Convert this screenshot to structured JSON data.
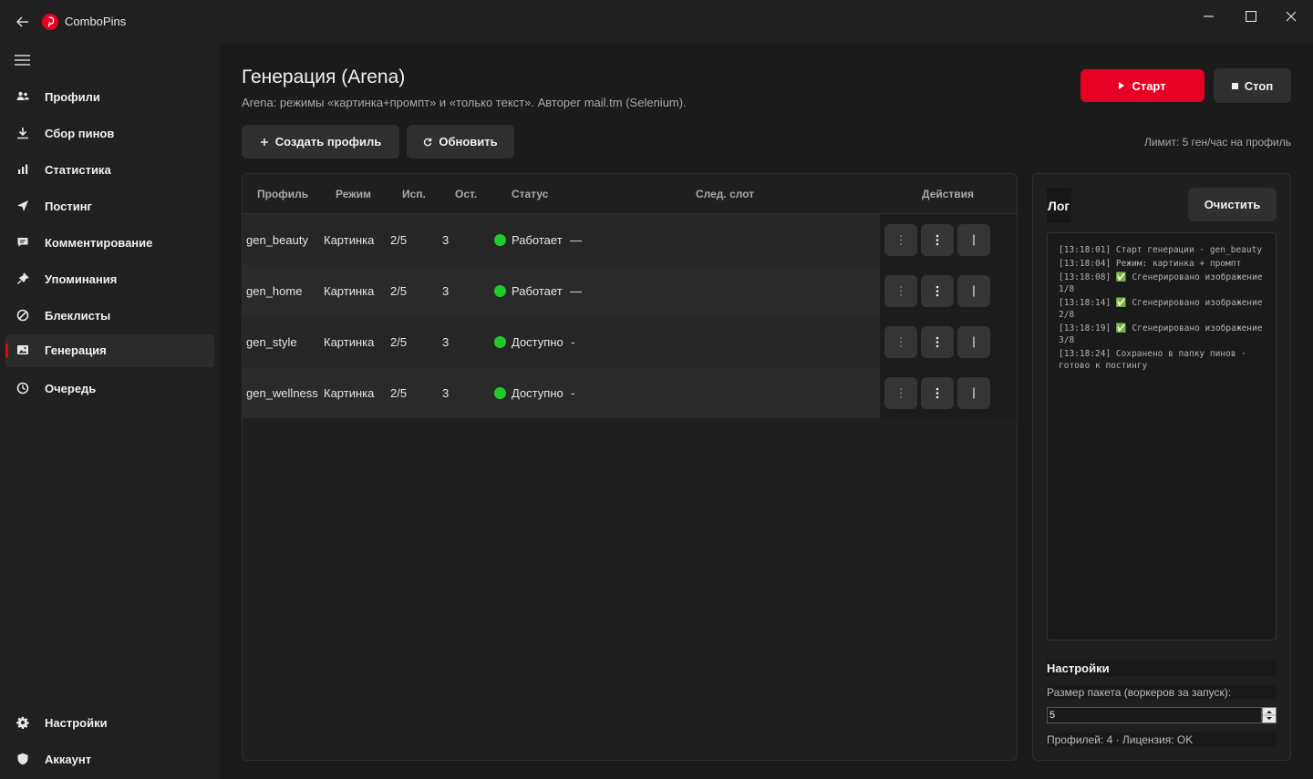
{
  "app": {
    "title": "ComboPins",
    "icons": {
      "logo": "pinterest-logo-icon",
      "back": "arrow-left-icon"
    }
  },
  "window_controls": {
    "icons": [
      "minimize-icon",
      "maximize-icon",
      "close-icon"
    ]
  },
  "sidebar": {
    "items": [
      {
        "label": "Профили",
        "icon": "users-icon"
      },
      {
        "label": "Сбор пинов",
        "icon": "download-icon"
      },
      {
        "label": "Статистика",
        "icon": "bar-chart-icon"
      },
      {
        "label": "Постинг",
        "icon": "send-icon"
      },
      {
        "label": "Комментирование",
        "icon": "comment-icon"
      },
      {
        "label": "Упоминания",
        "icon": "pin-icon"
      },
      {
        "label": "Блеклисты",
        "icon": "block-icon"
      },
      {
        "label": "Генерация",
        "icon": "image-icon",
        "active": true
      },
      {
        "label": "Очередь",
        "icon": "clock-icon"
      }
    ],
    "bottom_items": [
      {
        "label": "Настройки",
        "icon": "gear-icon"
      },
      {
        "label": "Аккаунт",
        "icon": "shield-icon"
      }
    ]
  },
  "header": {
    "title": "Генерация (Arena)",
    "subtitle": "Arena: режимы «картинка+промпт» и «только текст». Авторег mail.tm (Selenium).",
    "start_label": "Старт",
    "stop_label": "Стоп"
  },
  "toolbar": {
    "create_label": "Создать профиль",
    "refresh_label": "Обновить",
    "limit_text": "Лимит: 5 ген/час на профиль"
  },
  "table": {
    "columns": [
      "Профиль",
      "Режим",
      "Исп.",
      "Ост.",
      "Статус",
      "След. слот",
      "Действия"
    ],
    "rows": [
      {
        "profile": "gen_beauty",
        "mode": "Картинка",
        "used": "2/5",
        "left": "3",
        "status": "Работает",
        "slot": "—"
      },
      {
        "profile": "gen_home",
        "mode": "Картинка",
        "used": "2/5",
        "left": "3",
        "status": "Работает",
        "slot": "—"
      },
      {
        "profile": "gen_style",
        "mode": "Картинка",
        "used": "2/5",
        "left": "3",
        "status": "Доступно",
        "slot": "-"
      },
      {
        "profile": "gen_wellness",
        "mode": "Картинка",
        "used": "2/5",
        "left": "3",
        "status": "Доступно",
        "slot": "-"
      }
    ],
    "status_color": "#1fcb2a"
  },
  "log": {
    "title": "Лог",
    "clear_label": "Очистить",
    "lines": [
      "[13:18:01] Старт генерации · gen_beauty",
      "[13:18:04] Режим: картинка + промпт",
      "[13:18:08] ✅ Сгенерировано изображение 1/8",
      "[13:18:14] ✅ Сгенерировано изображение 2/8",
      "[13:18:19] ✅ Сгенерировано изображение 3/8",
      "[13:18:24] Сохранено в папку пинов · готово к постингу"
    ]
  },
  "settings": {
    "title": "Настройки",
    "batch_label": "Размер пакета (воркеров за запуск):",
    "batch_value": "5",
    "footer": "Профилей: 4 · Лицензия: OK"
  },
  "colors": {
    "accent": "#e60023",
    "background": "#1b1b1b",
    "sidebar": "#202020"
  }
}
